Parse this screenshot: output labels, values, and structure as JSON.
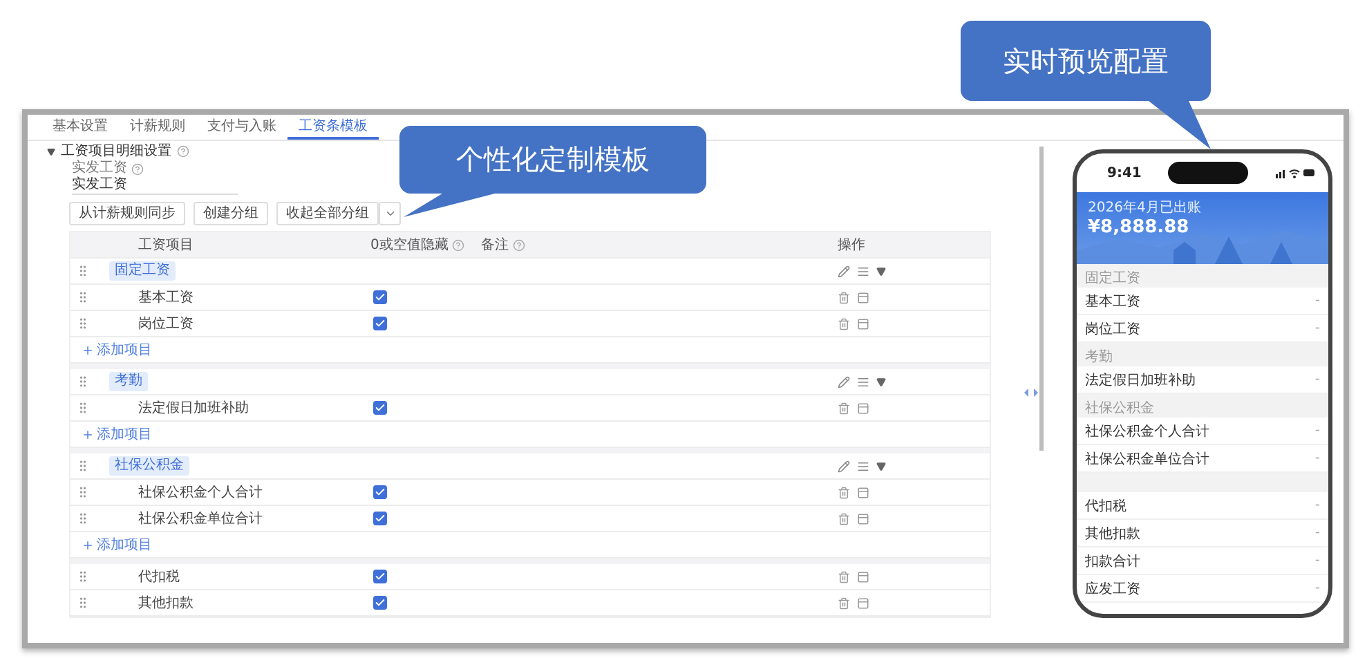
{
  "callouts": [
    {
      "text": "个性化定制模板"
    },
    {
      "text": "实时预览配置"
    }
  ],
  "tabs": [
    {
      "label": "基本设置",
      "selected": false
    },
    {
      "label": "计薪规则",
      "selected": false
    },
    {
      "label": "支付与入账",
      "selected": false
    },
    {
      "label": "工资条模板",
      "selected": true
    }
  ],
  "section": {
    "title": "工资项目明细设置",
    "expanded": true,
    "field_label": "实发工资",
    "field_value": "实发工资"
  },
  "toolbar": {
    "buttons": [
      "从计薪规则同步",
      "创建分组",
      "收起全部分组"
    ]
  },
  "table": {
    "columns": [
      "工资项目",
      "0或空值隐藏",
      "备注",
      "操作"
    ],
    "rows": [
      {
        "kind": "group",
        "label": "固定工资"
      },
      {
        "kind": "item",
        "label": "基本工资",
        "checked": true
      },
      {
        "kind": "item",
        "label": "岗位工资",
        "checked": true
      },
      {
        "kind": "add",
        "label": "添加项目"
      },
      {
        "kind": "group",
        "label": "考勤"
      },
      {
        "kind": "item",
        "label": "法定假日加班补助",
        "checked": true
      },
      {
        "kind": "add",
        "label": "添加项目"
      },
      {
        "kind": "group",
        "label": "社保公积金"
      },
      {
        "kind": "item",
        "label": "社保公积金个人合计",
        "checked": true
      },
      {
        "kind": "item",
        "label": "社保公积金单位合计",
        "checked": true
      },
      {
        "kind": "add",
        "label": "添加项目"
      },
      {
        "kind": "item",
        "label": "代扣税",
        "checked": true
      },
      {
        "kind": "item",
        "label": "其他扣款",
        "checked": true
      }
    ]
  },
  "phone": {
    "time": "9:41",
    "caption": "2026年4月已出账",
    "amount": "¥8,888.88",
    "sections": [
      {
        "title": "固定工资",
        "rows": [
          {
            "label": "基本工资",
            "value": "-"
          },
          {
            "label": "岗位工资",
            "value": "-"
          }
        ]
      },
      {
        "title": "考勤",
        "rows": [
          {
            "label": "法定假日加班补助",
            "value": "-"
          }
        ]
      },
      {
        "title": "社保公积金",
        "rows": [
          {
            "label": "社保公积金个人合计",
            "value": "-"
          },
          {
            "label": "社保公积金单位合计",
            "value": "-"
          }
        ]
      },
      {
        "rows": [
          {
            "label": "代扣税",
            "value": "-"
          },
          {
            "label": "其他扣款",
            "value": "-"
          },
          {
            "label": "扣款合计",
            "value": "-"
          },
          {
            "label": "应发工资",
            "value": "-"
          }
        ]
      }
    ]
  }
}
